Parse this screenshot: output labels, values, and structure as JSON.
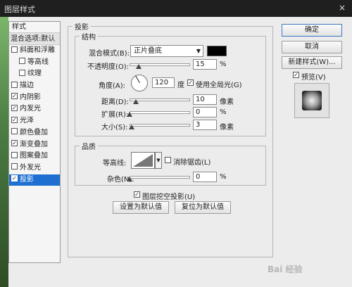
{
  "window": {
    "title": "图层样式",
    "close_glyph": "×"
  },
  "sidebar": {
    "header": "样式",
    "blend_options": "混合选项:默认",
    "items": [
      {
        "label": "斜面和浮雕",
        "checked": false,
        "indent": false
      },
      {
        "label": "等高线",
        "checked": false,
        "indent": true
      },
      {
        "label": "纹理",
        "checked": false,
        "indent": true
      },
      {
        "label": "描边",
        "checked": false,
        "indent": false
      },
      {
        "label": "内阴影",
        "checked": true,
        "indent": false
      },
      {
        "label": "内发光",
        "checked": true,
        "indent": false
      },
      {
        "label": "光泽",
        "checked": true,
        "indent": false
      },
      {
        "label": "颜色叠加",
        "checked": false,
        "indent": false
      },
      {
        "label": "渐变叠加",
        "checked": true,
        "indent": false
      },
      {
        "label": "图案叠加",
        "checked": false,
        "indent": false
      },
      {
        "label": "外发光",
        "checked": false,
        "indent": false
      },
      {
        "label": "投影",
        "checked": true,
        "indent": false,
        "selected": true
      }
    ]
  },
  "shadow": {
    "title": "投影",
    "structure": {
      "title": "结构",
      "blend_mode_label": "混合模式(B):",
      "blend_mode_value": "正片叠底",
      "color": "#000000",
      "opacity_label": "不透明度(O):",
      "opacity_value": "15",
      "opacity_fraction": 0.15,
      "percent": "%",
      "angle_label": "角度(A):",
      "angle_value": "120",
      "degree": "度",
      "global_light_label": "使用全局光(G)",
      "global_light": true,
      "distance_label": "距离(D):",
      "distance_value": "10",
      "spread_label": "扩展(R):",
      "spread_value": "0",
      "size_label": "大小(S):",
      "size_value": "3",
      "pixels": "像素"
    },
    "quality": {
      "title": "品质",
      "contour_label": "等高线:",
      "antialias_label": "消除锯齿(L)",
      "antialias": false,
      "noise_label": "杂色(N):",
      "noise_value": "0",
      "percent": "%"
    },
    "knockout_label": "图层挖空投影(U)",
    "knockout": true,
    "make_default": "设置为默认值",
    "reset_default": "复位为默认值"
  },
  "buttons": {
    "ok": "确定",
    "cancel": "取消",
    "new_style": "新建样式(W)...",
    "preview_label": "预览(V)",
    "preview": true
  },
  "watermark": "Bai 经验"
}
